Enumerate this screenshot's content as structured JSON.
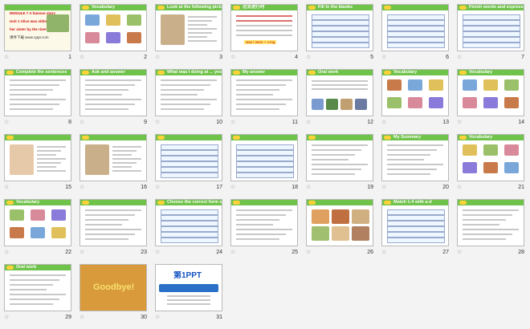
{
  "view": "slide-sorter",
  "colors": {
    "accent": "#6fc24a",
    "title_red": "#d01010",
    "body_blue": "#1030c0"
  },
  "slides": [
    {
      "number": "1",
      "title": "MODULE 7 A famous story",
      "body": [
        "Unit 1 Alice was sitting with",
        "her sister by the river",
        "课件下载 www.1ppt.com"
      ]
    },
    {
      "number": "2",
      "title": "Vocabulary",
      "body": []
    },
    {
      "number": "3",
      "title": "Look at the following pictures",
      "body": []
    },
    {
      "number": "4",
      "title": "过去进行时",
      "body": [
        "was / were + v-ing"
      ]
    },
    {
      "number": "5",
      "title": "Fill in the blanks",
      "body": []
    },
    {
      "number": "6",
      "title": "",
      "body": []
    },
    {
      "number": "7",
      "title": "Finish words and expressions",
      "body": []
    },
    {
      "number": "8",
      "title": "Complete the sentences",
      "body": []
    },
    {
      "number": "9",
      "title": "Ask and answer",
      "body": []
    },
    {
      "number": "10",
      "title": "What was I doing at ... yesterday?",
      "body": []
    },
    {
      "number": "11",
      "title": "My answer",
      "body": []
    },
    {
      "number": "12",
      "title": "Oral work",
      "body": []
    },
    {
      "number": "13",
      "title": "Vocabulary",
      "body": []
    },
    {
      "number": "14",
      "title": "Vocabulary",
      "body": []
    },
    {
      "number": "15",
      "title": "",
      "body": []
    },
    {
      "number": "16",
      "title": "",
      "body": []
    },
    {
      "number": "17",
      "title": "",
      "body": []
    },
    {
      "number": "18",
      "title": "",
      "body": []
    },
    {
      "number": "19",
      "title": "",
      "body": []
    },
    {
      "number": "20",
      "title": "My Summary",
      "body": []
    },
    {
      "number": "21",
      "title": "Vocabulary",
      "body": []
    },
    {
      "number": "22",
      "title": "Vocabulary",
      "body": []
    },
    {
      "number": "23",
      "title": "",
      "body": []
    },
    {
      "number": "24",
      "title": "Choose the correct form of the verbs",
      "body": []
    },
    {
      "number": "25",
      "title": "",
      "body": []
    },
    {
      "number": "26",
      "title": "",
      "body": []
    },
    {
      "number": "27",
      "title": "Match 1-4 with a-d",
      "body": []
    },
    {
      "number": "28",
      "title": "",
      "body": []
    },
    {
      "number": "29",
      "title": "Oral work",
      "body": []
    },
    {
      "number": "30",
      "title": "Goodbye!",
      "body": []
    },
    {
      "number": "31",
      "title": "第1PPT",
      "body": []
    }
  ]
}
